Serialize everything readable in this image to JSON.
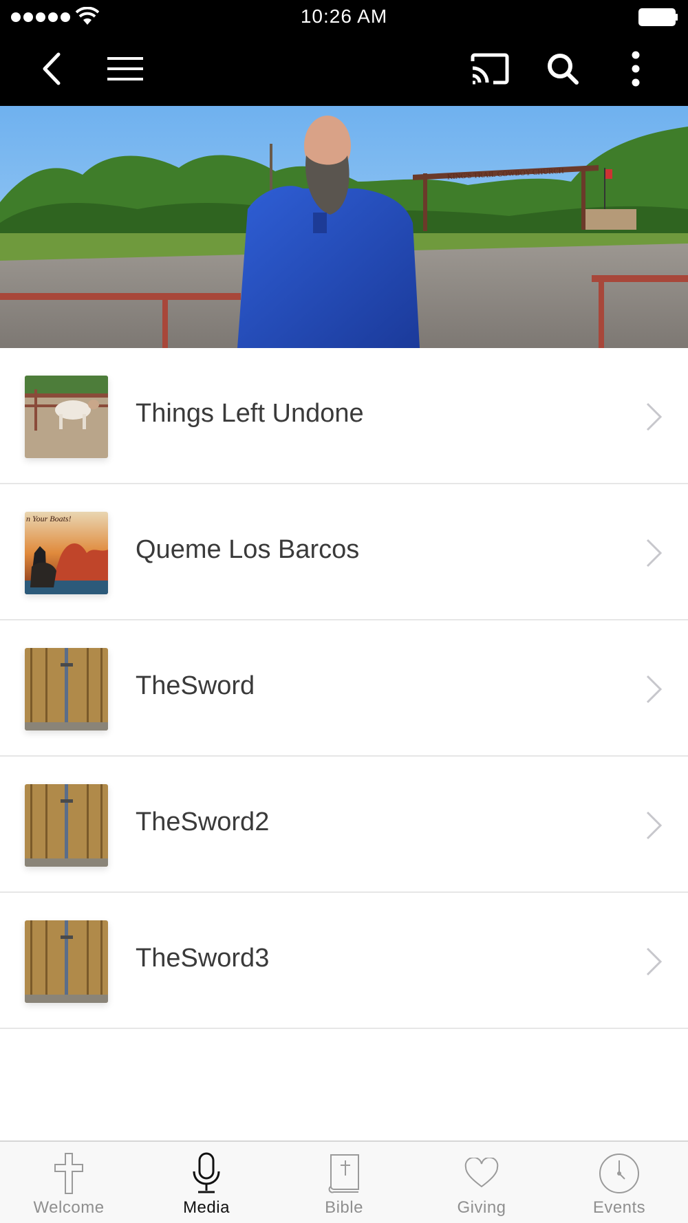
{
  "status_bar": {
    "time": "10:26 AM"
  },
  "nav": {
    "back_icon": "back-arrow-icon",
    "menu_icon": "hamburger-menu-icon",
    "cast_icon": "cast-icon",
    "search_icon": "search-icon",
    "more_icon": "more-vertical-icon"
  },
  "hero": {
    "sign_text": "KING'S TRAIL COWBOY CHURCH"
  },
  "list": {
    "items": [
      {
        "title": "Things Left Undone",
        "thumb": "cattle-in-pen"
      },
      {
        "title": "Queme Los Barcos",
        "thumb": "burning-ships",
        "thumb_text": "n Your Boats!"
      },
      {
        "title": "TheSword",
        "thumb": "wooden-door-cross"
      },
      {
        "title": "TheSword2",
        "thumb": "wooden-door-cross"
      },
      {
        "title": "TheSword3",
        "thumb": "wooden-door-cross"
      }
    ]
  },
  "tabbar": {
    "tabs": [
      {
        "label": "Welcome",
        "icon": "cross-icon",
        "active": false
      },
      {
        "label": "Media",
        "icon": "microphone-icon",
        "active": true
      },
      {
        "label": "Bible",
        "icon": "bible-icon",
        "active": false
      },
      {
        "label": "Giving",
        "icon": "heart-icon",
        "active": false
      },
      {
        "label": "Events",
        "icon": "clock-icon",
        "active": false
      }
    ]
  },
  "colors": {
    "nav_background": "#000000",
    "active_tab": "#111111",
    "inactive_tab": "#8f8f8f",
    "divider": "#e6e6e6"
  }
}
